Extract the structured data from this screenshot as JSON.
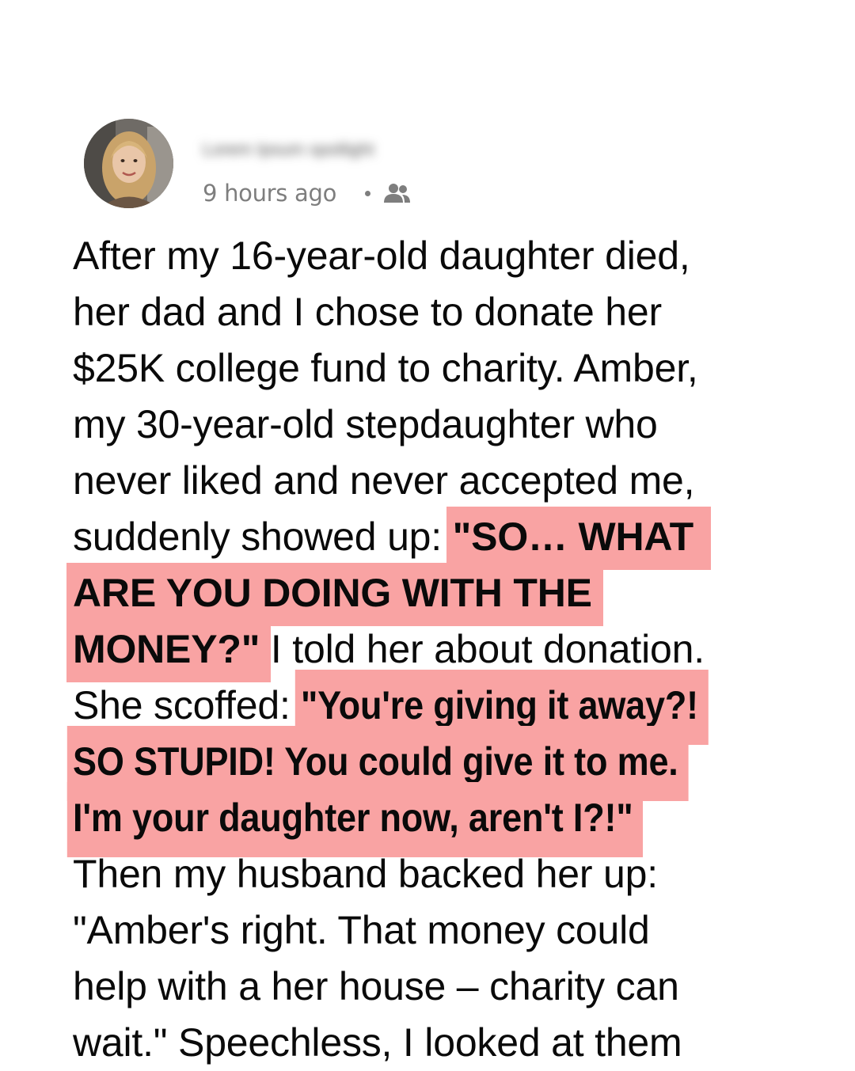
{
  "post": {
    "author_name": "Lorem Ipsum spotlight",
    "timestamp": "9 hours ago",
    "audience_icon": "friends-icon",
    "colors": {
      "highlight": "#f9a3a3",
      "text": "#0a0a0a",
      "meta": "#7e7e7e"
    },
    "lines": [
      {
        "plain": "After my 16-year-old daughter died,"
      },
      {
        "plain": "her dad and I chose to donate her"
      },
      {
        "plain": "$25K college fund to charity. Amber,"
      },
      {
        "plain": "my 30-year-old stepdaughter who"
      },
      {
        "plain": "never liked and never accepted me,"
      },
      {
        "plain": "suddenly showed up: ",
        "highlight": "\"SO… WHAT"
      },
      {
        "highlight": "ARE YOU DOING WITH THE"
      },
      {
        "highlight": "MONEY?\"",
        "plain_after": " I told her about donation."
      },
      {
        "plain": "She scoffed: ",
        "highlight": "\"You're giving it away?!"
      },
      {
        "highlight": "SO STUPID! You could give it to me."
      },
      {
        "highlight": "I'm your daughter now, aren't I?!\""
      },
      {
        "plain": "Then my husband backed her up:"
      },
      {
        "plain": "\"Amber's right. That money could"
      },
      {
        "plain": "help with a her house – charity can"
      },
      {
        "plain": "wait.\" Speechless, I looked at them"
      }
    ]
  }
}
